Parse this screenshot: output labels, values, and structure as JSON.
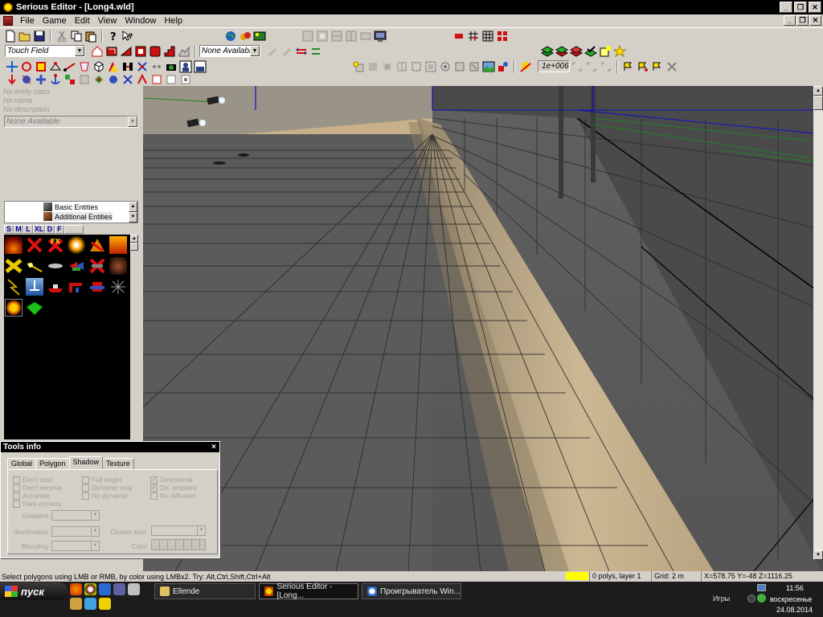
{
  "window": {
    "title": "Serious Editor - [Long4.wld]",
    "menu": [
      "File",
      "Game",
      "Edit",
      "View",
      "Window",
      "Help"
    ],
    "min_glyph": "_",
    "restore_glyph": "❐",
    "close_glyph": "✕"
  },
  "toolbar": {
    "mode_combo": "Touch Field",
    "avail_combo": "None Available",
    "value_box": "1e+006",
    "combo_arrow": "▼"
  },
  "entity": {
    "info": [
      "No entity class",
      "No name",
      "No description"
    ],
    "combo": "None Available"
  },
  "tree": {
    "nodes": [
      "Basic Entities",
      "Additional Entities"
    ]
  },
  "palette_tabs": [
    "S",
    "M",
    "L",
    "XL",
    "D",
    "F"
  ],
  "palette_icons": [
    "fire-icon",
    "red-x-icon",
    "fx-icon",
    "flare-icon",
    "warning-icon",
    "explosion-icon",
    "chain-icon",
    "beam-icon",
    "fish-icon",
    "marker-icon",
    "red-x-icon",
    "debris-icon",
    "lightning-icon",
    "boat-icon",
    "ship-icon",
    "pipe-icon",
    "robot-icon",
    "spark-icon",
    "serious-sam-icon",
    "terrain-icon"
  ],
  "tools_info": {
    "title": "Tools info",
    "close": "×",
    "tabs": [
      "Global",
      "Polygon",
      "Shadow",
      "Texture"
    ],
    "active_tab": "Shadow",
    "checkboxes_col1": [
      "Don't cast",
      "Don't receive",
      "Accurate",
      "Dark corners"
    ],
    "checkboxes_col2": [
      "Full bright",
      "Dynamic only",
      "No dynamic"
    ],
    "checkboxes_col3": [
      "Directional",
      "Dir. ambient",
      "No diffusion"
    ],
    "checked_col3": [
      true,
      true,
      false
    ],
    "fields": [
      "Gradient",
      "Illumination",
      "Blending"
    ],
    "cluster_label": "Cluster size:",
    "color_label": "Color"
  },
  "status": {
    "message": "Select polygons using LMB or RMB, by color using LMBx2. Try: Alt,Ctrl,Shift,Ctrl+Alt",
    "polys": "0 polys, layer 1",
    "grid": "Grid: 2 m",
    "coords": "X=578.75 Y=-48 Z=1116.25",
    "highlight_color": "#ffff00"
  },
  "taskbar": {
    "start": "пуск",
    "tasks": [
      "Ellende",
      "Serious Editor - [Long...",
      "Проигрыватель Win..."
    ],
    "tray_label": "Игры",
    "time": "11:56",
    "day": "воскресенье",
    "date": "24.08.2014"
  }
}
